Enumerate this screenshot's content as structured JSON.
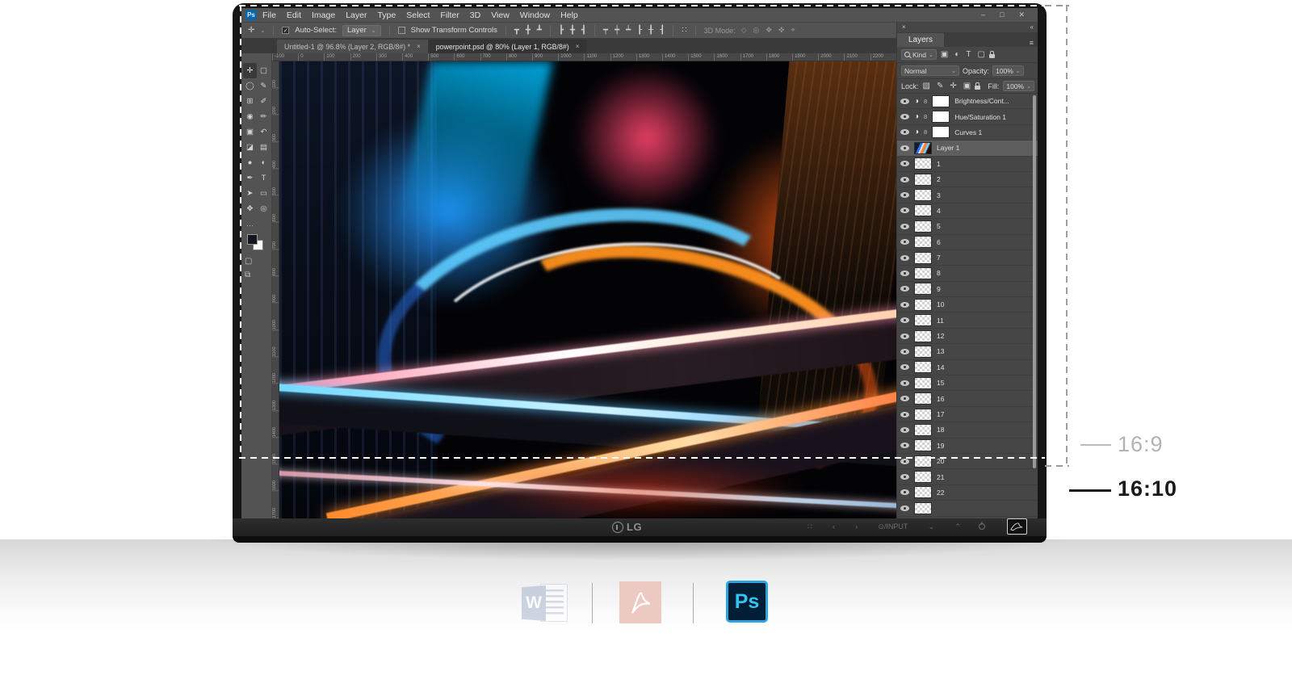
{
  "annotations": {
    "ratio_wide": "16:9",
    "ratio_tall": "16:10"
  },
  "monitor": {
    "brand": "LG",
    "controls": [
      {
        "name": "menu-button",
        "glyph": "∷"
      },
      {
        "name": "prev-button",
        "glyph": "‹"
      },
      {
        "name": "next-button",
        "glyph": "›"
      },
      {
        "name": "input-button",
        "glyph": "⊙/INPUT"
      },
      {
        "name": "down-button",
        "glyph": "⌄"
      },
      {
        "name": "up-button",
        "glyph": "⌃"
      }
    ]
  },
  "ps": {
    "logo": "Ps",
    "menus": [
      "File",
      "Edit",
      "Image",
      "Layer",
      "Type",
      "Select",
      "Filter",
      "3D",
      "View",
      "Window",
      "Help"
    ],
    "window_controls": {
      "minimize": "–",
      "maximize": "□",
      "close": "✕"
    },
    "options": {
      "move_tool_glyph": "✛",
      "auto_select_label": "Auto-Select:",
      "target_value": "Layer",
      "show_transform_label": "Show Transform Controls",
      "align_icons_1": [
        "┳",
        "╋",
        "┻"
      ],
      "align_icons_2": [
        "┣",
        "╋",
        "┫"
      ],
      "distribute_icons": [
        "┯",
        "┿",
        "┷",
        "┠",
        "╂",
        "┨"
      ],
      "extra_icon": "∷",
      "mode_label": "3D Mode:",
      "mode_icons": [
        "◇",
        "◎",
        "✥",
        "✜",
        "⌖"
      ]
    },
    "tabs": [
      {
        "title": "Untitled-1 @ 96.8% (Layer 2, RGB/8#) *",
        "close": "×"
      },
      {
        "title": "powerpoint.psd @ 80% (Layer 1, RGB/8#)",
        "close": "×"
      }
    ],
    "tools": [
      {
        "name": "move-tool",
        "glyph": "✛",
        "active": true
      },
      {
        "name": "marquee-tool",
        "glyph": "▢"
      },
      {
        "name": "lasso-tool",
        "glyph": "◯"
      },
      {
        "name": "quick-select-tool",
        "glyph": "✎"
      },
      {
        "name": "crop-tool",
        "glyph": "⊞"
      },
      {
        "name": "eyedropper-tool",
        "glyph": "✐"
      },
      {
        "name": "healing-brush-tool",
        "glyph": "◉"
      },
      {
        "name": "brush-tool",
        "glyph": "✏"
      },
      {
        "name": "clone-stamp-tool",
        "glyph": "▣"
      },
      {
        "name": "history-brush-tool",
        "glyph": "↶"
      },
      {
        "name": "eraser-tool",
        "glyph": "◪"
      },
      {
        "name": "gradient-tool",
        "glyph": "▤"
      },
      {
        "name": "blur-tool",
        "glyph": "●"
      },
      {
        "name": "dodge-tool",
        "glyph": "◐"
      },
      {
        "name": "pen-tool",
        "glyph": "✒"
      },
      {
        "name": "type-tool",
        "glyph": "T"
      },
      {
        "name": "path-select-tool",
        "glyph": "➤"
      },
      {
        "name": "shape-tool",
        "glyph": "▭"
      },
      {
        "name": "hand-tool",
        "glyph": "✥"
      },
      {
        "name": "zoom-tool",
        "glyph": "◎"
      }
    ],
    "toolbar_ellipsis": "⋯",
    "toolbar_bottom_icons": [
      "▢",
      "⧉"
    ],
    "hruler": [
      "-100",
      "0",
      "100",
      "200",
      "300",
      "400",
      "500",
      "600",
      "700",
      "800",
      "900",
      "1000",
      "1100",
      "1200",
      "1300",
      "1400",
      "1500",
      "1600",
      "1700",
      "1800",
      "1900",
      "2000",
      "2100",
      "2200"
    ],
    "vruler": [
      "100",
      "200",
      "300",
      "400",
      "500",
      "600",
      "700",
      "800",
      "900",
      "1000",
      "1100",
      "1200",
      "1300",
      "1400",
      "1500",
      "1600",
      "1700"
    ],
    "panel": {
      "close": "×",
      "collapse": "«",
      "title": "Layers",
      "menu_icon": "≡",
      "filter_label": "Kind",
      "filter_icons": [
        "▣",
        "◐",
        "T",
        "▢"
      ],
      "blend_mode": "Normal",
      "opacity_label": "Opacity:",
      "opacity_value": "100%",
      "lock_label": "Lock:",
      "lock_icons": [
        "▨",
        "✎",
        "✛",
        "▣"
      ],
      "fill_label": "Fill:",
      "fill_value": "100%",
      "caret": "⌄",
      "adjustment_layers": [
        {
          "label": "Brightness/Cont...",
          "adj_glyph": "◑",
          "link_glyph": "8"
        },
        {
          "label": "Hue/Saturation 1",
          "adj_glyph": "◑",
          "link_glyph": "8"
        },
        {
          "label": "Curves 1",
          "adj_glyph": "◑",
          "link_glyph": "8"
        }
      ],
      "selected_layer": "Layer 1",
      "numbered_layers": [
        "1",
        "2",
        "3",
        "4",
        "5",
        "6",
        "7",
        "8",
        "9",
        "10",
        "11",
        "12",
        "13",
        "14",
        "15",
        "16",
        "17",
        "18",
        "19",
        "20",
        "21",
        "22"
      ]
    }
  },
  "dock": {
    "word_letter": "W",
    "ps_label": "Ps"
  }
}
